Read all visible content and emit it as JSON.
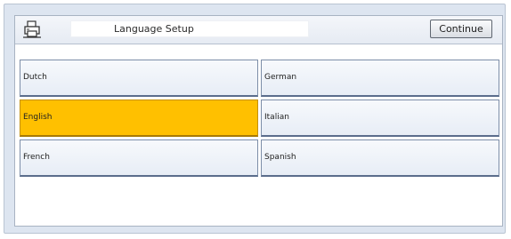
{
  "header": {
    "icon": "printer-icon",
    "title": "Language Setup",
    "continue_label": "Continue"
  },
  "languages": [
    {
      "label": "Dutch",
      "selected": false
    },
    {
      "label": "German",
      "selected": false
    },
    {
      "label": "English",
      "selected": true
    },
    {
      "label": "Italian",
      "selected": false
    },
    {
      "label": "French",
      "selected": false
    },
    {
      "label": "Spanish",
      "selected": false
    }
  ],
  "colors": {
    "selected": "#ffc000",
    "button": "#eef2f8",
    "frame": "#dde5f0"
  }
}
